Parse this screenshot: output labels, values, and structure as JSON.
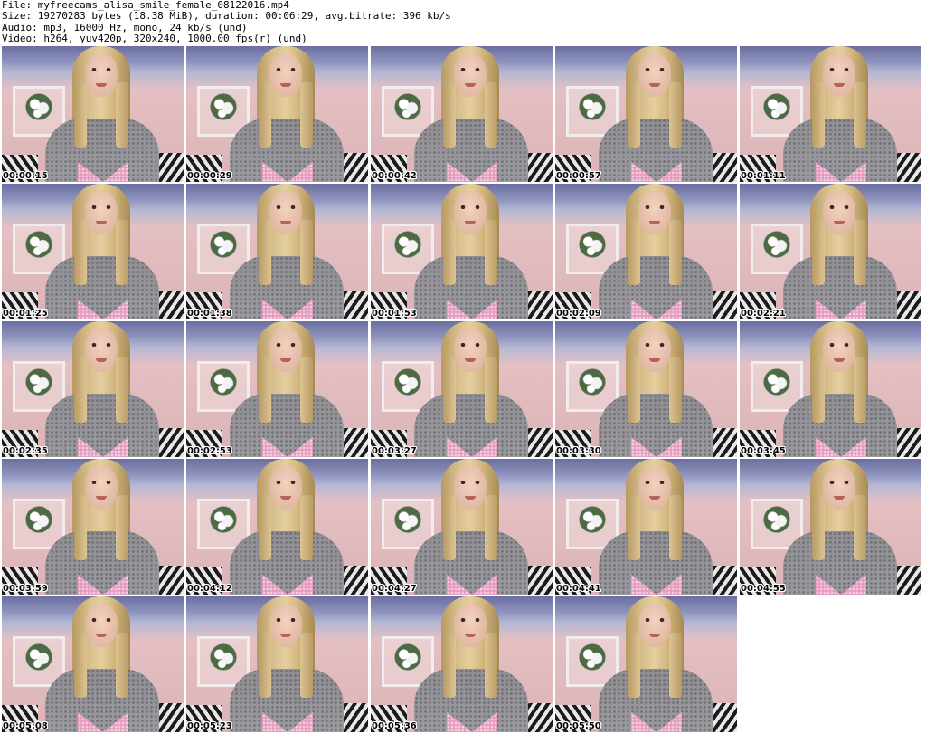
{
  "header": {
    "file_line": "File: myfreecams_alisa_smile_female_08122016.mp4",
    "size_line": "Size: 19270283 bytes (18.38 MiB), duration: 00:06:29, avg.bitrate: 396 kb/s",
    "audio_line": "Audio: mp3, 16000 Hz, mono, 24 kb/s (und)",
    "video_line": "Video: h264, yuv420p, 320x240, 1000.00 fps(r) (und)"
  },
  "thumbnails": [
    {
      "timestamp": "00:00:15"
    },
    {
      "timestamp": "00:00:29"
    },
    {
      "timestamp": "00:00:42"
    },
    {
      "timestamp": "00:00:57"
    },
    {
      "timestamp": "00:01:11"
    },
    {
      "timestamp": "00:01:25"
    },
    {
      "timestamp": "00:01:38"
    },
    {
      "timestamp": "00:01:53"
    },
    {
      "timestamp": "00:02:09"
    },
    {
      "timestamp": "00:02:21"
    },
    {
      "timestamp": "00:02:35"
    },
    {
      "timestamp": "00:02:53"
    },
    {
      "timestamp": "00:03:27"
    },
    {
      "timestamp": "00:03:30"
    },
    {
      "timestamp": "00:03:45"
    },
    {
      "timestamp": "00:03:59"
    },
    {
      "timestamp": "00:04:12"
    },
    {
      "timestamp": "00:04:27"
    },
    {
      "timestamp": "00:04:41"
    },
    {
      "timestamp": "00:04:55"
    },
    {
      "timestamp": "00:05:08"
    },
    {
      "timestamp": "00:05:23"
    },
    {
      "timestamp": "00:05:36"
    },
    {
      "timestamp": "00:05:50"
    }
  ]
}
